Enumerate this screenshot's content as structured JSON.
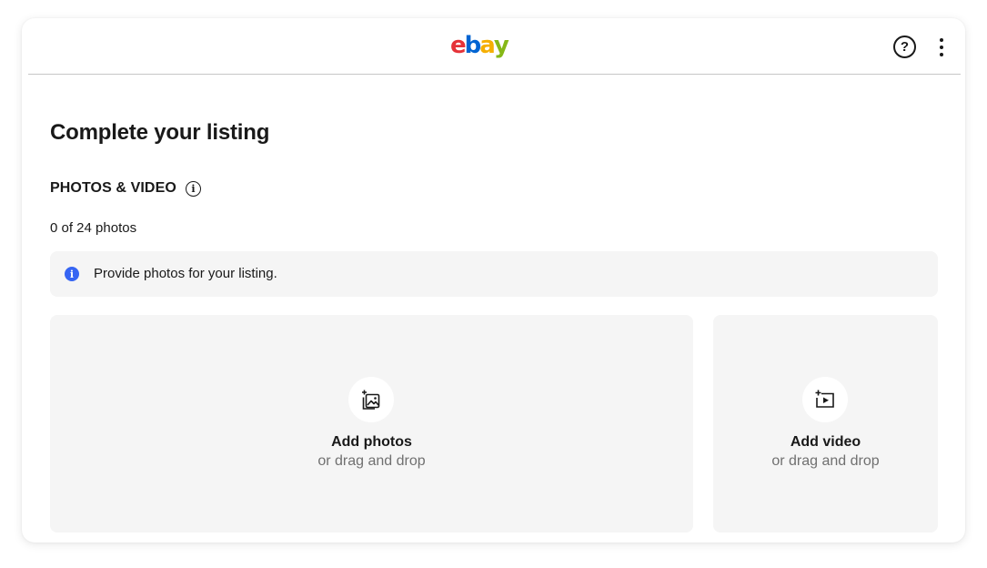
{
  "header": {
    "logo": {
      "text": "ebay",
      "letters": [
        {
          "char": "e",
          "color": "#e53238"
        },
        {
          "char": "b",
          "color": "#0064d2"
        },
        {
          "char": "a",
          "color": "#f5af02"
        },
        {
          "char": "y",
          "color": "#86b817"
        }
      ]
    },
    "help_icon_text": "?",
    "help_icon": "help-circle-icon",
    "more_icon": "more-vertical-icon"
  },
  "page": {
    "title": "Complete your listing"
  },
  "photos_section": {
    "title": "PHOTOS & VIDEO",
    "info_icon": "info-outline-icon",
    "info_icon_text": "i",
    "count_text": "0 of 24 photos",
    "notice": {
      "icon": "info-filled-icon",
      "icon_text": "i",
      "icon_color": "#3665f3",
      "text": "Provide photos for your listing."
    },
    "add_photos": {
      "icon": "add-photo-icon",
      "label": "Add photos",
      "sublabel": "or drag and drop"
    },
    "add_video": {
      "icon": "add-video-icon",
      "label": "Add video",
      "sublabel": "or drag and drop"
    }
  },
  "colors": {
    "text": "#191919",
    "muted": "#707070",
    "panel": "#f5f5f5",
    "divider": "#c7c7c7",
    "accent": "#3665f3"
  }
}
